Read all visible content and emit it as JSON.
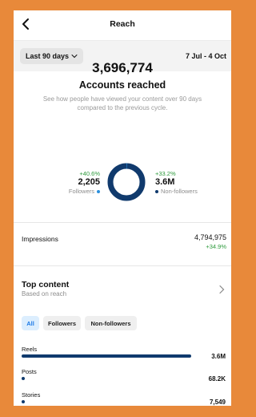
{
  "header": {
    "title": "Reach"
  },
  "range": {
    "label": "Last 90 days",
    "dates": "7 Jul - 4 Oct"
  },
  "summary": {
    "accounts_reached": "3,696,774",
    "label": "Accounts reached",
    "description": "See how people have viewed your content over 90 days compared to the previous cycle."
  },
  "audience": {
    "followers": {
      "change": "+40.6%",
      "value": "2,205",
      "label": "Followers",
      "color": "#2b8fdc"
    },
    "non_followers": {
      "change": "+33.2%",
      "value": "3.6M",
      "label": "Non-followers",
      "color": "#103a6d"
    }
  },
  "impressions": {
    "label": "Impressions",
    "value": "4,794,975",
    "change": "+34.9%"
  },
  "top_content": {
    "title": "Top content",
    "subtitle": "Based on reach"
  },
  "filters": {
    "all": "All",
    "followers": "Followers",
    "non_followers": "Non-followers"
  },
  "content_types": [
    {
      "label": "Reels",
      "value": "3.6M",
      "fraction": 0.98
    },
    {
      "label": "Posts",
      "value": "68.2K",
      "fraction": 0.02
    },
    {
      "label": "Stories",
      "value": "7,549",
      "fraction": 0.003
    }
  ],
  "colors": {
    "accent": "#1e7ae6",
    "positive": "#2e9b3d",
    "bar": "#103a6d"
  }
}
